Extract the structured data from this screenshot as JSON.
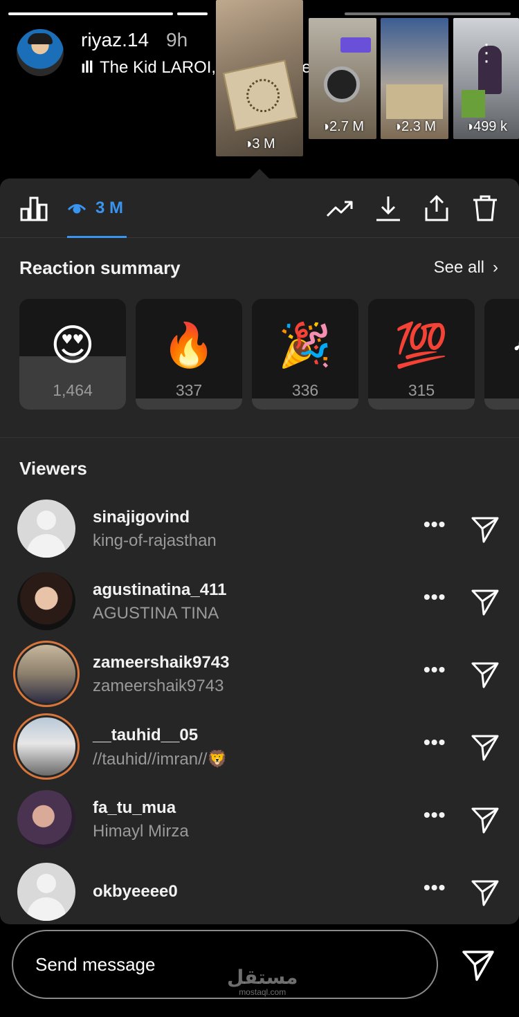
{
  "story": {
    "username": "riyaz.14",
    "age": "9h",
    "music": {
      "bars_icon": "music-bars-icon",
      "text": "The Kid LAROI, Justin Bieber • STAY",
      "explicit_badge": "E",
      "chevron": "›"
    },
    "thumbnails": [
      {
        "views": "◑3 M"
      },
      {
        "views": "◑2.7 M"
      },
      {
        "views": "◑2.3 M"
      },
      {
        "views": "◑499 k"
      }
    ],
    "progress_segments": 3
  },
  "toolbar": {
    "views_count": "3 M",
    "icons": [
      "insights-icon",
      "eye-icon",
      "trending-icon",
      "download-icon",
      "share-icon",
      "trash-icon"
    ]
  },
  "reactions": {
    "title": "Reaction summary",
    "see_all": "See all",
    "items": [
      {
        "emoji": "😍",
        "count": "1,464",
        "fill": 0.48
      },
      {
        "emoji": "🔥",
        "count": "337",
        "fill": 0.1
      },
      {
        "emoji": "🎉",
        "count": "336",
        "fill": 0.1
      },
      {
        "emoji": "💯",
        "count": "315",
        "fill": 0.1
      },
      {
        "emoji": "😂",
        "count": "",
        "fill": 0.1
      }
    ]
  },
  "viewers": {
    "title": "Viewers",
    "items": [
      {
        "username": "sinajigovind",
        "subtitle": "king-of-rajasthan"
      },
      {
        "username": "agustinatina_411",
        "subtitle": "AGUSTINA TINA"
      },
      {
        "username": "zameershaik9743",
        "subtitle": "zameershaik9743"
      },
      {
        "username": "__tauhid__05",
        "subtitle": "//tauhid//imran//🦁"
      },
      {
        "username": "fa_tu_mua",
        "subtitle": "Himayl Mirza"
      },
      {
        "username": "okbyeeee0",
        "subtitle": ""
      }
    ],
    "more_label": "•••"
  },
  "composer": {
    "placeholder": "Send message"
  },
  "watermark": {
    "arabic": "مستقل",
    "latin": "mostaql.com"
  },
  "colors": {
    "accent": "#3a95f0",
    "sheet": "#262626",
    "story_ring": "#d6763c"
  }
}
